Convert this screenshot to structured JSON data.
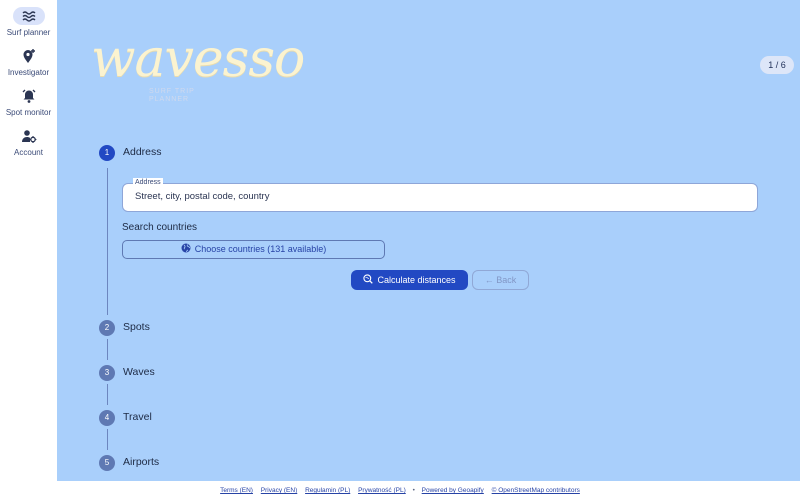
{
  "sidebar": {
    "items": [
      {
        "label": "Surf planner",
        "icon": "waves-icon",
        "active": true
      },
      {
        "label": "Investigator",
        "icon": "location-add-icon"
      },
      {
        "label": "Spot monitor",
        "icon": "alarm-bell-icon"
      },
      {
        "label": "Account",
        "icon": "user-gear-icon"
      }
    ]
  },
  "logo": {
    "word": "wavesso",
    "subtitle_line1": "SURF TRIP",
    "subtitle_line2": "PLANNER"
  },
  "page_badge": "1 / 6",
  "steps": [
    {
      "number": "1",
      "label": "Address",
      "active": true
    },
    {
      "number": "2",
      "label": "Spots"
    },
    {
      "number": "3",
      "label": "Waves"
    },
    {
      "number": "4",
      "label": "Travel"
    },
    {
      "number": "5",
      "label": "Airports"
    }
  ],
  "address": {
    "legend": "Address",
    "value": "",
    "placeholder": "Street, city, postal code, country"
  },
  "search_countries": {
    "label": "Search countries",
    "button": "Choose countries (131 available)"
  },
  "actions": {
    "calculate": "Calculate distances",
    "back": "Back"
  },
  "footer": {
    "links": [
      "Terms (EN)",
      "Privacy (EN)",
      "Regulamin (PL)",
      "Prywatność (PL)"
    ],
    "separator": "•",
    "powered": "Powered by Geoapify",
    "osm": "© OpenStreetMap contributors"
  },
  "colors": {
    "main_background": "#a9cffb",
    "primary": "#2249c3",
    "logo": "#fbf3d0"
  }
}
